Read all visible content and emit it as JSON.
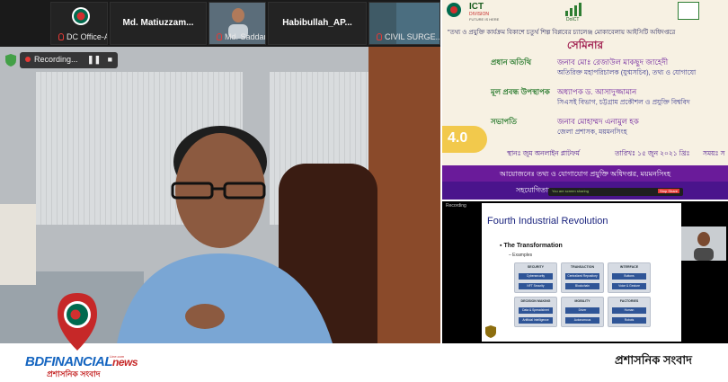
{
  "participants": [
    {
      "name": "DC Office-Ad",
      "kind": "logo"
    },
    {
      "name": "Md. Matiuzzam...",
      "kind": "text"
    },
    {
      "name": "Md. Saddam...",
      "kind": "video"
    },
    {
      "name": "Habibullah_AP...",
      "kind": "text"
    },
    {
      "name": "CIVIL SURGE...",
      "kind": "video"
    }
  ],
  "recording": {
    "label": "Recording..."
  },
  "banner": {
    "org": "ICT",
    "org_sub": "DIVISION",
    "org_tag": "FUTURE IS HERE",
    "ict2": "DoICT",
    "title": "\"তথ্য ও প্রযুক্তি কার্যক্রম বিকাশে চতুর্থ শিল্প বিপ্লবের চ্যালেঞ্জ মোকাবেলায় আইসিটি অধিদপ্তরে",
    "seminar": "সেমিনার",
    "rows": [
      {
        "role": "প্রধান অতিথি",
        "person": "জনাব মোঃ রেজাউল মাকছুদ জাহেদী",
        "designation": "অতিরিক্ত মহাপরিচালক (যুগ্মসচিব), তথ্য ও যোগাযো"
      },
      {
        "role": "মূল প্রবন্ধ উপস্থাপক",
        "person": "অধ্যাপক ড. আসাদুজ্জামান",
        "designation": "সিএসই বিভাগ, চট্টগ্রাম প্রকৌশল ও প্রযুক্তি বিশ্ববিদ"
      },
      {
        "role": "সভাপতি",
        "person": "জনাব মোহাম্মদ এনামুল হক",
        "designation": "জেলা প্রশাসক, ময়মনসিংহ"
      }
    ],
    "badge": "4.0",
    "venue": "স্থানঃ জুম অনলাইন প্লাটফর্ম",
    "date": "তারিখঃ ১৫ জুন ২০২১ খ্রিঃ",
    "time": "সময়ঃ স",
    "organizer": "আয়োজনেঃ তথ্য ও যোগাযোগ প্রযুক্তি অধিদপ্তর, ময়মনসিংহ",
    "cooperation": "সহযোগিতায়"
  },
  "presentation": {
    "title": "Fourth Industrial Revolution",
    "bullet": "The Transformation",
    "sub": "Examples",
    "cards": [
      {
        "head": "SECURITY",
        "top": "Cybersecurity",
        "bottom": "NFT Security"
      },
      {
        "head": "TRANSACTION",
        "top": "Centralized Repository",
        "bottom": "Blockchain"
      },
      {
        "head": "INTERFACE",
        "top": "Buttons",
        "bottom": "Voice & Gesture"
      },
      {
        "head": "DECISION MAKING",
        "top": "Data & Spreadsheet",
        "bottom": "Artificial Intelligence"
      },
      {
        "head": "MOBILITY",
        "top": "Driver",
        "bottom": "Autonomous"
      },
      {
        "head": "FACTORIES",
        "top": "Human",
        "bottom": "Robots"
      }
    ],
    "recording": "Recording",
    "share": "You are screen sharing",
    "stop": "Stop Share"
  },
  "footer": {
    "brand": "BDFINANCIAL",
    "brand_news": "news",
    "brand_sub": "Line.com",
    "tagline": "প্রশাসনিক সংবাদ",
    "right": "প্রশাসনিক সংবাদ"
  },
  "colors": {
    "brand_red": "#c62828",
    "brand_blue": "#1565c0",
    "banner_purple": "#6a1b9a"
  }
}
